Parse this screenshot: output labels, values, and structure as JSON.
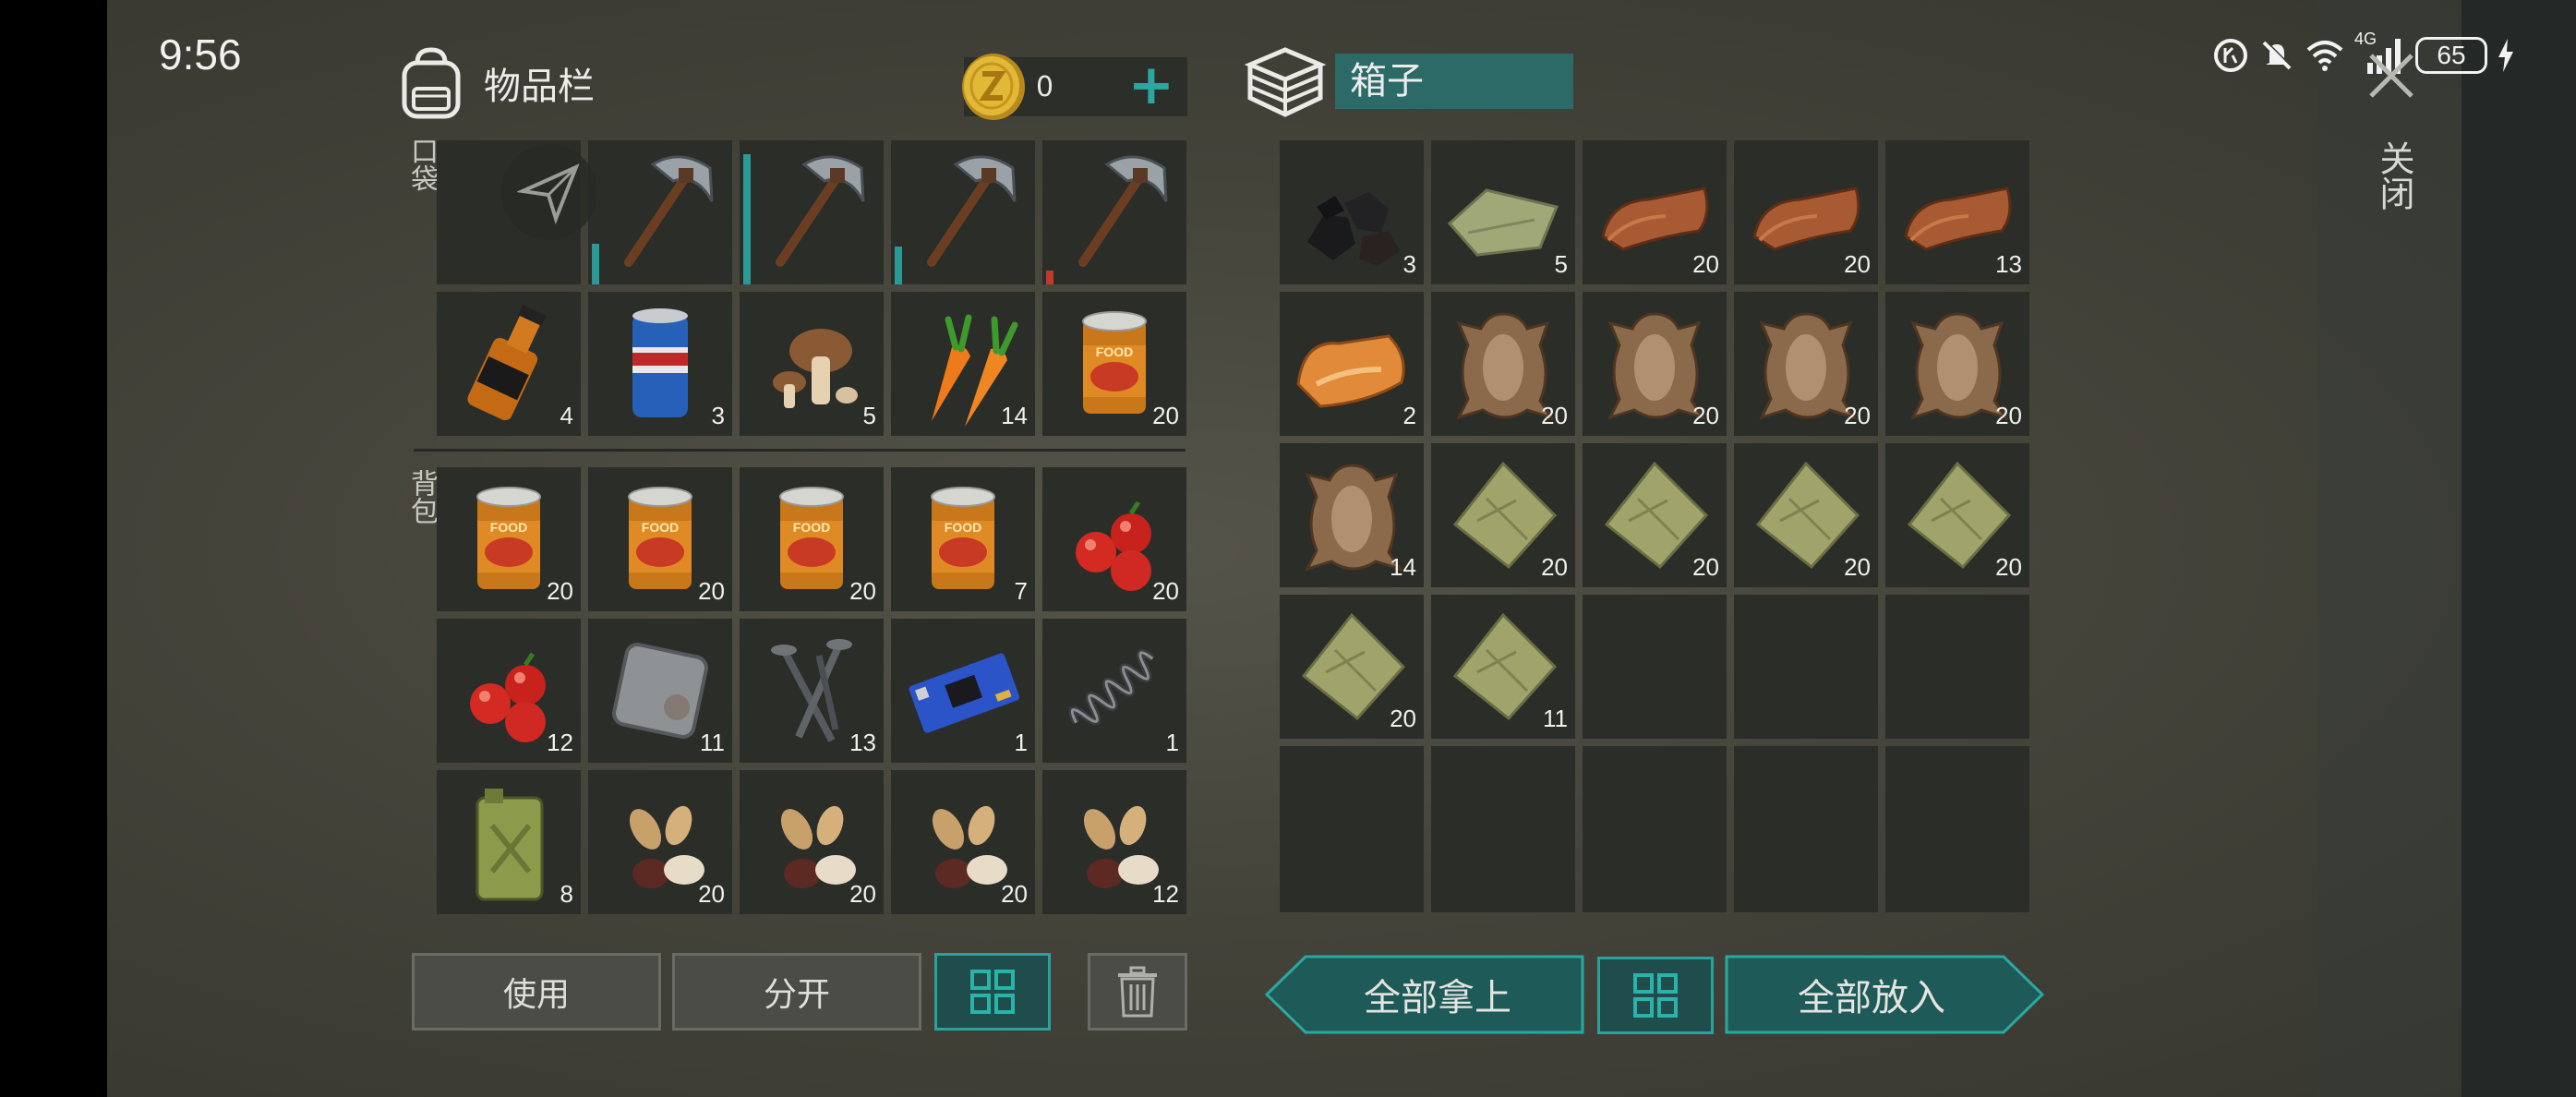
{
  "status_bar": {
    "time": "9:56",
    "network": "4G",
    "battery": "65"
  },
  "inventory": {
    "title": "物品栏",
    "pocket_label": "口袋",
    "backpack_label": "背包",
    "coins": "0"
  },
  "box": {
    "title": "箱子"
  },
  "close_label": "关闭",
  "buttons": {
    "use": "使用",
    "split": "分开",
    "take_all": "全部拿上",
    "put_all": "全部放入"
  },
  "pocket_slots": [
    {
      "item": "share-icon",
      "qty": ""
    },
    {
      "item": "pickaxe",
      "qty": "",
      "durability": 0.3,
      "dur_color": "#2a9a96"
    },
    {
      "item": "pickaxe",
      "qty": "",
      "durability": 0.95,
      "dur_color": "#2a9a96"
    },
    {
      "item": "pickaxe",
      "qty": "",
      "durability": 0.28,
      "dur_color": "#2a9a96"
    },
    {
      "item": "pickaxe",
      "qty": "",
      "durability": 0.1,
      "dur_color": "#c0392b"
    },
    {
      "item": "whiskey",
      "qty": "4"
    },
    {
      "item": "beer-can",
      "qty": "3"
    },
    {
      "item": "mushroom",
      "qty": "5"
    },
    {
      "item": "carrot",
      "qty": "14"
    },
    {
      "item": "food-can",
      "qty": "20"
    }
  ],
  "backpack_slots": [
    {
      "item": "food-can",
      "qty": "20"
    },
    {
      "item": "food-can",
      "qty": "20"
    },
    {
      "item": "food-can",
      "qty": "20"
    },
    {
      "item": "food-can",
      "qty": "7"
    },
    {
      "item": "berries",
      "qty": "20"
    },
    {
      "item": "berries",
      "qty": "12"
    },
    {
      "item": "metal-plate",
      "qty": "11"
    },
    {
      "item": "nails",
      "qty": "13"
    },
    {
      "item": "circuit-board",
      "qty": "1"
    },
    {
      "item": "spring",
      "qty": "1"
    },
    {
      "item": "fuel-canister",
      "qty": "8"
    },
    {
      "item": "seeds",
      "qty": "20"
    },
    {
      "item": "seeds",
      "qty": "20"
    },
    {
      "item": "seeds",
      "qty": "20"
    },
    {
      "item": "seeds",
      "qty": "12"
    }
  ],
  "box_slots": [
    {
      "item": "coal",
      "qty": "3"
    },
    {
      "item": "cloth",
      "qty": "5"
    },
    {
      "item": "leather",
      "qty": "20"
    },
    {
      "item": "leather",
      "qty": "20"
    },
    {
      "item": "leather",
      "qty": "13"
    },
    {
      "item": "fox-fur",
      "qty": "2"
    },
    {
      "item": "animal-hide",
      "qty": "20"
    },
    {
      "item": "animal-hide",
      "qty": "20"
    },
    {
      "item": "animal-hide",
      "qty": "20"
    },
    {
      "item": "animal-hide",
      "qty": "20"
    },
    {
      "item": "animal-hide",
      "qty": "14"
    },
    {
      "item": "rag",
      "qty": "20"
    },
    {
      "item": "rag",
      "qty": "20"
    },
    {
      "item": "rag",
      "qty": "20"
    },
    {
      "item": "rag",
      "qty": "20"
    },
    {
      "item": "rag",
      "qty": "20"
    },
    {
      "item": "rag",
      "qty": "11"
    },
    {
      "item": "",
      "qty": ""
    },
    {
      "item": "",
      "qty": ""
    },
    {
      "item": "",
      "qty": ""
    },
    {
      "item": "",
      "qty": ""
    },
    {
      "item": "",
      "qty": ""
    },
    {
      "item": "",
      "qty": ""
    },
    {
      "item": "",
      "qty": ""
    },
    {
      "item": "",
      "qty": ""
    }
  ]
}
